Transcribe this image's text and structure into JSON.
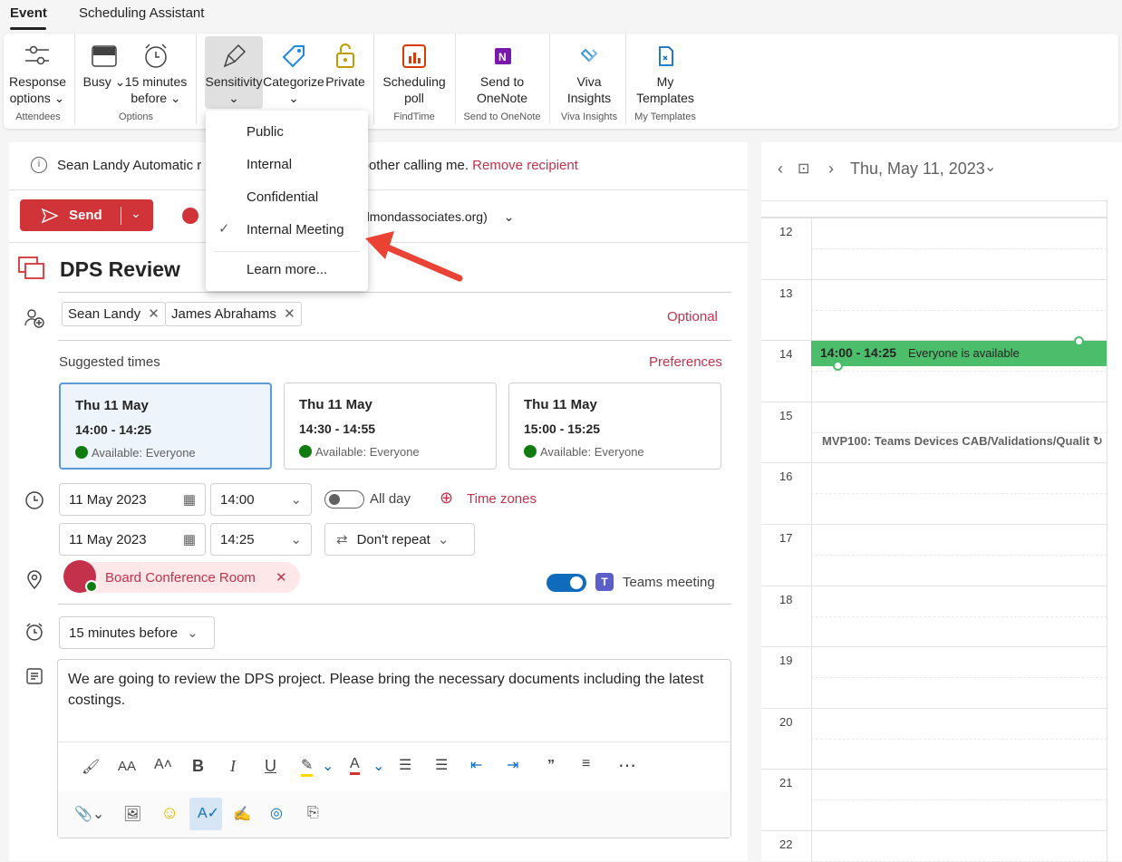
{
  "tabs": {
    "event": "Event",
    "scheduling": "Scheduling Assistant"
  },
  "ribbon": {
    "response_options": {
      "line1": "Response",
      "line2": "options"
    },
    "busy": "Busy",
    "reminder": {
      "line1": "15 minutes",
      "line2": "before"
    },
    "sensitivity": "Sensitivity",
    "categorize": "Categorize",
    "private": "Private",
    "scheduling_poll": {
      "line1": "Scheduling",
      "line2": "poll"
    },
    "send_onenote": {
      "line1": "Send to",
      "line2": "OneNote"
    },
    "viva": {
      "line1": "Viva",
      "line2": "Insights"
    },
    "templates": {
      "line1": "My",
      "line2": "Templates"
    },
    "groups": {
      "attendees": "Attendees",
      "options": "Options",
      "findtime": "FindTime",
      "onenote": "Send to OneNote",
      "viva": "Viva Insights",
      "templates": "My Templates"
    }
  },
  "sensitivity_menu": {
    "items": [
      "Public",
      "Internal",
      "Confidential",
      "Internal Meeting"
    ],
    "selected": "Internal Meeting",
    "learn_more": "Learn more..."
  },
  "infobar": {
    "text_start": "Sean Landy Automatic r",
    "text_end": "t bother calling me.",
    "link": "Remove recipient"
  },
  "send": {
    "label": "Send",
    "from_partial": "dmondassociates.org)"
  },
  "event": {
    "title": "DPS Review"
  },
  "attendees": [
    "Sean Landy",
    "James Abrahams"
  ],
  "optional_label": "Optional",
  "suggested": {
    "label": "Suggested times",
    "preferences": "Preferences",
    "cards": [
      {
        "date": "Thu 11 May",
        "time": "14:00 - 14:25",
        "avail": "Available: Everyone"
      },
      {
        "date": "Thu 11 May",
        "time": "14:30 - 14:55",
        "avail": "Available: Everyone"
      },
      {
        "date": "Thu 11 May",
        "time": "15:00 - 15:25",
        "avail": "Available: Everyone"
      }
    ]
  },
  "datetime": {
    "start_date": "11 May 2023",
    "start_time": "14:00",
    "end_date": "11 May 2023",
    "end_time": "14:25",
    "all_day": "All day",
    "time_zones": "Time zones",
    "repeat": "Don't repeat"
  },
  "location": {
    "room": "Board Conference Room",
    "teams": "Teams meeting"
  },
  "reminder": "15 minutes before",
  "body": "We are going to review the DPS project. Please bring the necessary documents including the latest costings.",
  "calendar": {
    "date": "Thu, May 11, 2023",
    "hours": [
      "12",
      "13",
      "14",
      "15",
      "16",
      "17",
      "18",
      "19",
      "20",
      "21",
      "22"
    ],
    "event1": {
      "time": "14:00 - 14:25",
      "note": "Everyone is available"
    },
    "event2": "MVP100: Teams Devices CAB/Validations/Qualit"
  },
  "colors": {
    "accent_red": "#c4314b",
    "send_red": "#d13438",
    "event_green": "#4cbd6a",
    "toggle_blue": "#0f6cbd"
  }
}
